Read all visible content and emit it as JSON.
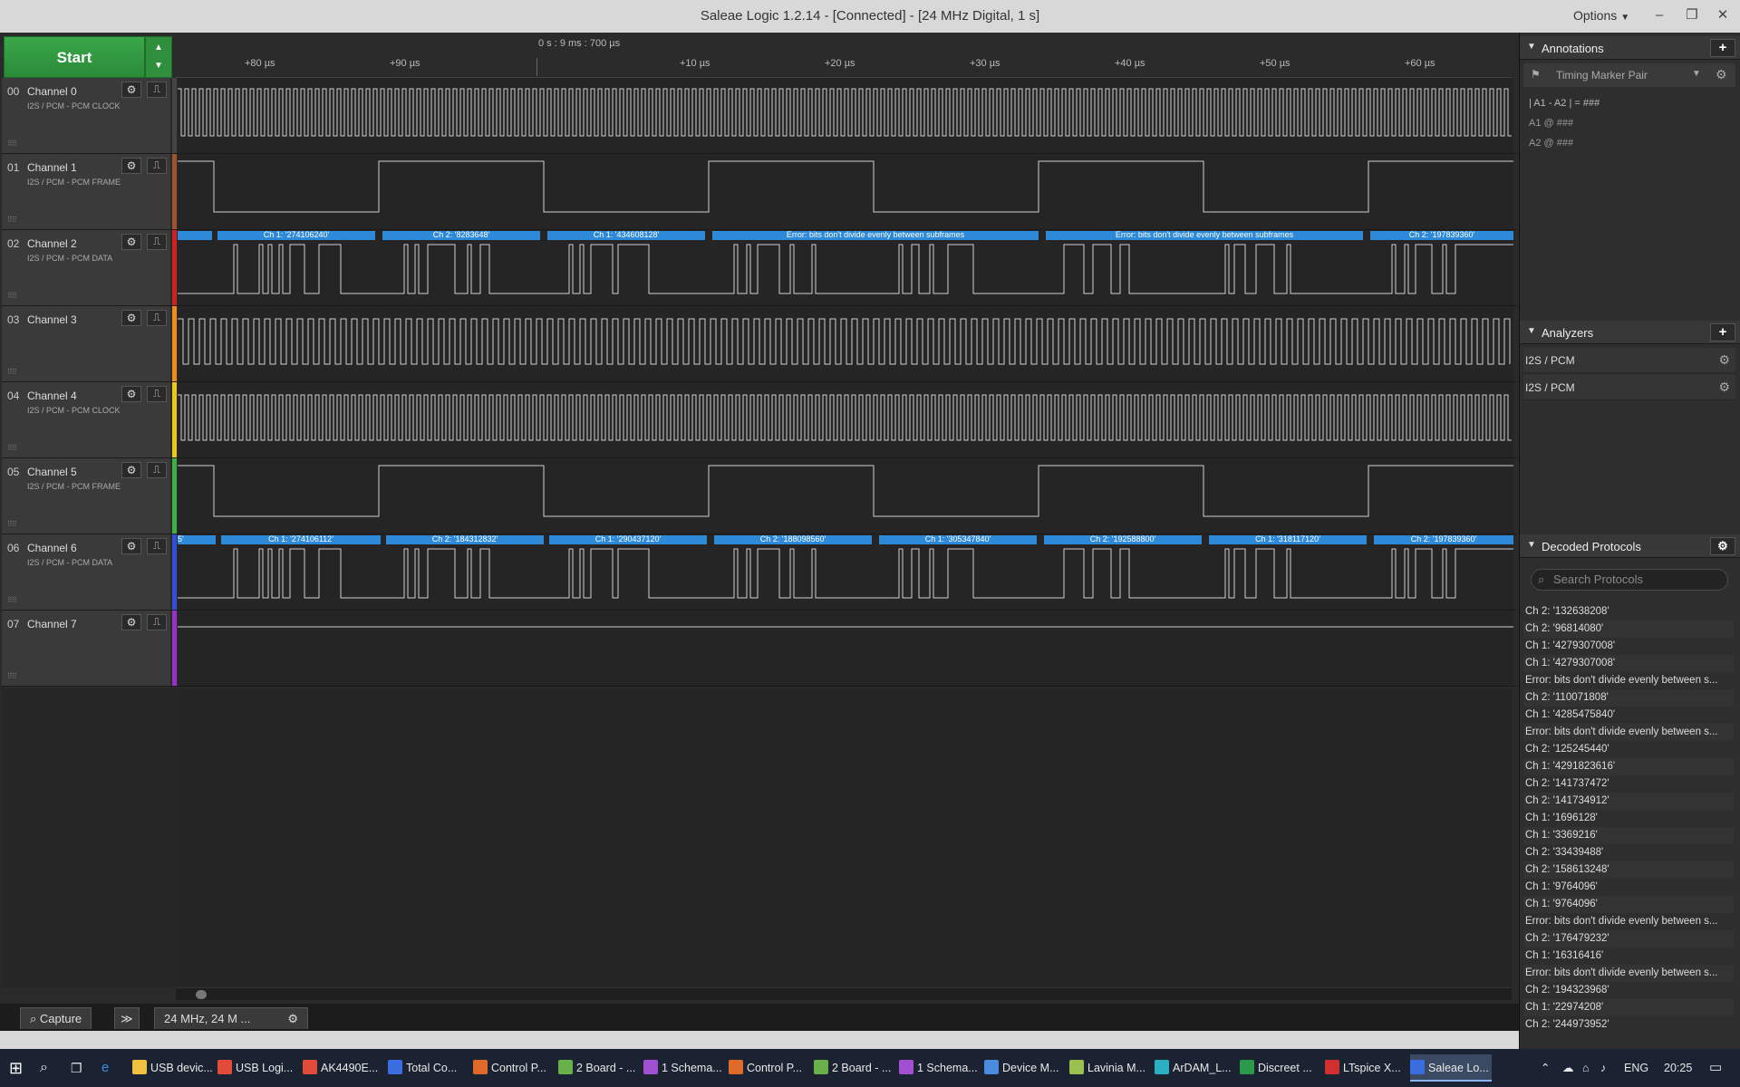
{
  "window": {
    "title": "Saleae Logic 1.2.14 - [Connected] - [24 MHz Digital, 1 s]",
    "options_label": "Options",
    "minimize": "–",
    "maximize": "❐",
    "close": "✕"
  },
  "controls": {
    "start_label": "Start"
  },
  "ruler": {
    "center_time": "0 s : 9 ms : 700 µs",
    "ticks": [
      "+80 µs",
      "+90 µs",
      "+10 µs",
      "+20 µs",
      "+30 µs",
      "+40 µs",
      "+50 µs",
      "+60 µs"
    ]
  },
  "channels": [
    {
      "num": "00",
      "name": "Channel 0",
      "sub": "I2S / PCM - PCM CLOCK",
      "color": "#444444"
    },
    {
      "num": "01",
      "name": "Channel 1",
      "sub": "I2S / PCM - PCM FRAME",
      "color": "#a0522d"
    },
    {
      "num": "02",
      "name": "Channel 2",
      "sub": "I2S / PCM - PCM DATA",
      "color": "#d02020"
    },
    {
      "num": "03",
      "name": "Channel 3",
      "sub": "",
      "color": "#f08c1a"
    },
    {
      "num": "04",
      "name": "Channel 4",
      "sub": "I2S / PCM - PCM CLOCK",
      "color": "#e8c81a"
    },
    {
      "num": "05",
      "name": "Channel 5",
      "sub": "I2S / PCM - PCM FRAME",
      "color": "#3cb043"
    },
    {
      "num": "06",
      "name": "Channel 6",
      "sub": "I2S / PCM - PCM DATA",
      "color": "#3050d8"
    },
    {
      "num": "07",
      "name": "Channel 7",
      "sub": "",
      "color": "#9b30c8"
    }
  ],
  "decode_ch2": [
    "",
    "Ch 1: '274106240'",
    "Ch 2: '8283648'",
    "Ch 1: '434608128'",
    "Error: bits don't divide evenly between subframes",
    "Error: bits don't divide evenly between subframes",
    "Ch 2: '197839360'"
  ],
  "decode_ch6": [
    "5'",
    "Ch 1: '274106112'",
    "Ch 2: '184312832'",
    "Ch 1: '290437120'",
    "Ch 2: '188098560'",
    "Ch 1: '305347840'",
    "Ch 2: '192588800'",
    "Ch 1: '318117120'",
    "Ch 2: '197839360'"
  ],
  "bottom": {
    "capture_tab": "Capture",
    "more": "≫",
    "session_tab": "24 MHz, 24 M ..."
  },
  "annotations": {
    "title": "Annotations",
    "add": "+",
    "marker_label": "Timing Marker Pair",
    "line1": "| A1 - A2 | = ###",
    "line2": "A1  @  ###",
    "line3": "A2  @  ###"
  },
  "analyzers": {
    "title": "Analyzers",
    "add": "+",
    "items": [
      "I2S / PCM",
      "I2S / PCM"
    ]
  },
  "decoded": {
    "title": "Decoded Protocols",
    "search_placeholder": "Search Protocols",
    "items": [
      "Ch 2: '132638208'",
      "Ch 2: '96814080'",
      "Ch 1: '4279307008'",
      "Ch 1: '4279307008'",
      "Error: bits don't divide evenly between s...",
      "Ch 2: '110071808'",
      "Ch 1: '4285475840'",
      "Error: bits don't divide evenly between s...",
      "Ch 2: '125245440'",
      "Ch 1: '4291823616'",
      "Ch 2: '141737472'",
      "Ch 2: '141734912'",
      "Ch 1: '1696128'",
      "Ch 1: '3369216'",
      "Ch 2: '33439488'",
      "Ch 2: '158613248'",
      "Ch 1: '9764096'",
      "Ch 1: '9764096'",
      "Error: bits don't divide evenly between s...",
      "Ch 2: '176479232'",
      "Ch 1: '16316416'",
      "Error: bits don't divide evenly between s...",
      "Ch 2: '194323968'",
      "Ch 1: '22974208'",
      "Ch 2: '244973952'"
    ]
  },
  "taskbar": {
    "items": [
      "USB devic...",
      "USB Logi...",
      "AK4490E...",
      "Total Co...",
      "Control P...",
      "2 Board - ...",
      "1 Schema...",
      "Control P...",
      "2 Board - ...",
      "1 Schema...",
      "Device M...",
      "Lavinia M...",
      "ArDAM_L...",
      "Discreet ...",
      "LTspice X...",
      "Saleae Lo..."
    ],
    "lang": "ENG",
    "time": "20:25"
  }
}
